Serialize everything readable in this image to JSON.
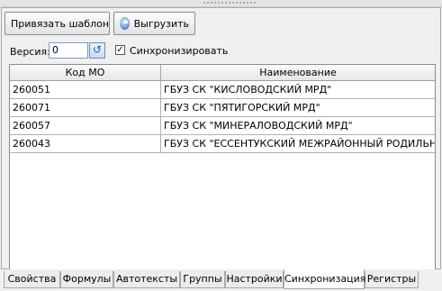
{
  "toolbar": {
    "bind_template_label": "Привязать шаблон",
    "export_label": "Выгрузить"
  },
  "version": {
    "label": "Версия:",
    "value": "0",
    "sync_label": "Синхронизировать",
    "sync_checked": true
  },
  "grid": {
    "columns": [
      "Код МО",
      "Наименование"
    ],
    "rows": [
      {
        "code": "260051",
        "name": "ГБУЗ СК \"КИСЛОВОДСКИЙ МРД\""
      },
      {
        "code": "260071",
        "name": "ГБУЗ СК \"ПЯТИГОРСКИЙ МРД\""
      },
      {
        "code": "260057",
        "name": "ГБУЗ СК \"МИНЕРАЛОВОДСКИЙ МРД\""
      },
      {
        "code": "260043",
        "name": "ГБУЗ СК \"ЕССЕНТУКСКИЙ МЕЖРАЙОННЫЙ РОДИЛЬНЫЙ"
      }
    ]
  },
  "tabs": [
    {
      "label": "Свойства"
    },
    {
      "label": "Формулы"
    },
    {
      "label": "Автотексты"
    },
    {
      "label": "Группы"
    },
    {
      "label": "Настройки"
    },
    {
      "label": "Синхронизация",
      "active": true
    },
    {
      "label": "Регистры"
    }
  ],
  "icons": {
    "export": "upload-globe-icon",
    "refresh": "refresh-icon",
    "checkbox": "checkmark-icon"
  }
}
